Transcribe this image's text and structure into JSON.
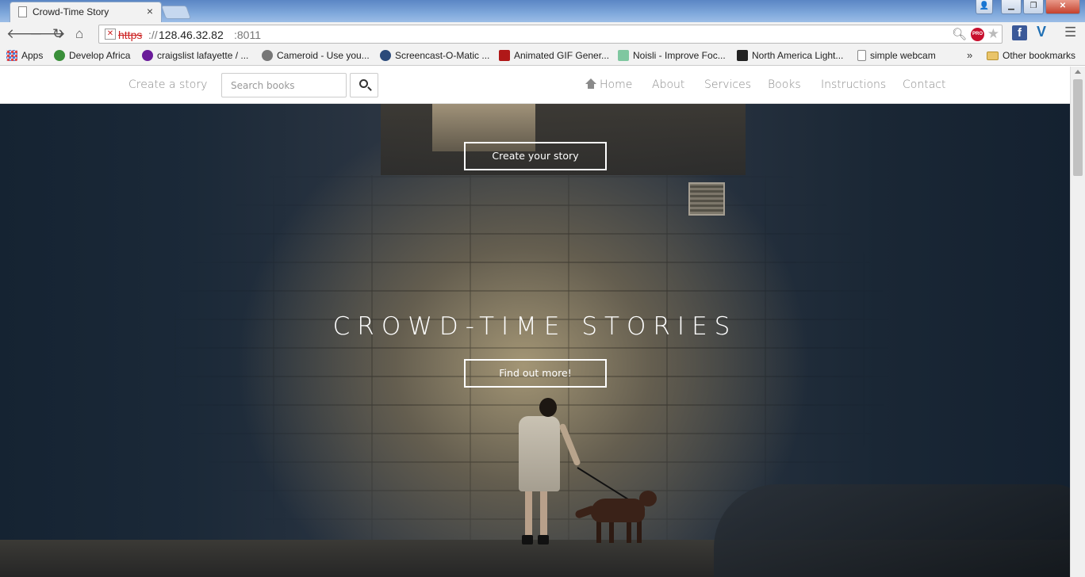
{
  "browser": {
    "tab_title": "Crowd-Time Story",
    "tab_close": "×",
    "url": {
      "scheme": "https",
      "separator": "://",
      "host": "128.46.32.82",
      "port": ":8011"
    },
    "window_buttons": {
      "user": "👤",
      "minimize": "▁",
      "maximize": "❐",
      "close": "✕"
    },
    "extensions": {
      "pro_badge": "PRO",
      "facebook": "f",
      "vimeo": "V"
    },
    "bookmarks": [
      {
        "label": "Apps",
        "icon": "apps-grid-icon",
        "color": "#d44"
      },
      {
        "label": "Develop Africa",
        "icon": "globe-icon",
        "color": "#3a8f3a"
      },
      {
        "label": "craigslist lafayette / ...",
        "icon": "peace-icon",
        "color": "#6a1b9a"
      },
      {
        "label": "Cameroid - Use you...",
        "icon": "camera-icon",
        "color": "#777"
      },
      {
        "label": "Screencast-O-Matic ...",
        "icon": "screencast-icon",
        "color": "#2b4a7a"
      },
      {
        "label": "Animated GIF Gener...",
        "icon": "gif-icon",
        "color": "#b01818"
      },
      {
        "label": "Noisli - Improve Foc...",
        "icon": "noisli-icon",
        "color": "#7fc7a0"
      },
      {
        "label": "North America Light...",
        "icon": "map-icon",
        "color": "#222"
      },
      {
        "label": "simple webcam",
        "icon": "page-icon",
        "color": "#ffffff"
      }
    ],
    "bookmarks_more": "»",
    "other_bookmarks": "Other bookmarks"
  },
  "site": {
    "nav": {
      "create_story": "Create a story",
      "search_placeholder": "Search books",
      "home": "Home",
      "about": "About",
      "services": "Services",
      "books": "Books",
      "instructions": "Instructions",
      "contact": "Contact"
    },
    "hero": {
      "create_button": "Create your story",
      "title": "CROWD-TIME STORIES",
      "find_button": "Find out more!"
    }
  }
}
